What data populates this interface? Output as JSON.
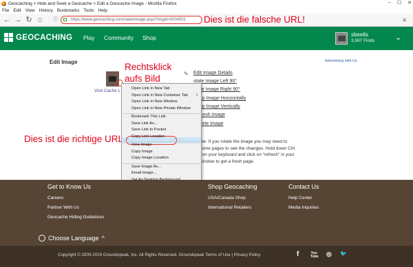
{
  "window": {
    "title": "Geocaching > Hide and Seek a Geocache > Edit a Geocache Image - Mozilla Firefox",
    "controls": {
      "minimize": "–",
      "maximize": "☐",
      "close": "✕"
    }
  },
  "menubar": [
    "File",
    "Edit",
    "View",
    "History",
    "Bookmarks",
    "Tools",
    "Help"
  ],
  "browser": {
    "url": "https://www.geocaching.com/seek/image.aspx?imgid=5004501",
    "icons": [
      "back-icon",
      "forward-icon",
      "reload-icon",
      "home-icon",
      "info-icon",
      "lock-icon",
      "menu-icon"
    ]
  },
  "annotations": {
    "url_note": "Dies ist die falsche URL!",
    "right_click": "Rechtsklick\naufs Bild",
    "correct_url": "Dies ist die richtige URL"
  },
  "header": {
    "logo": "GEOCACHING",
    "nav": [
      "Play",
      "Community",
      "Shop"
    ],
    "username": "sbeelis",
    "finds": "3,597 Finds"
  },
  "main": {
    "title": "Edit Image",
    "ads_link": "Advertising with Us",
    "visit_link": "Visit Cache L",
    "side_links": [
      "Edit Image Details",
      "Rotate Image Left 90°",
      "Rotate Image Right 90°",
      "Flip Image Horizontally",
      "Flip Image Vertically",
      "Refresh Image",
      "Delete Image"
    ],
    "side_links_visible": [
      "Edit Image Details",
      "otate Image Left 90°",
      "otate Image Right 90°",
      "ip Image Horizontally",
      "ip Image Vertically",
      "resh Image",
      "lete Image"
    ],
    "help_text": "ote: If you rotate the image you may need to\nsome pages to see the changes. Hold down Ctrl\nt on your keyboard and click on “refresh” in your\nwindow to get a fresh page."
  },
  "context_menu": {
    "items": [
      {
        "label": "Open Link in New Tab",
        "sub": false
      },
      {
        "label": "Open Link in New Container Tab",
        "sub": true
      },
      {
        "label": "Open Link in New Window",
        "sub": false
      },
      {
        "label": "Open Link in New Private Window",
        "sub": false
      },
      {
        "sep": true
      },
      {
        "label": "Bookmark This Link",
        "sub": false
      },
      {
        "label": "Save Link As...",
        "sub": false
      },
      {
        "label": "Save Link to Pocket",
        "sub": false
      },
      {
        "label": "Copy Link Location",
        "sub": false,
        "highlighted": true
      },
      {
        "sep": true
      },
      {
        "label": "View Image",
        "sub": false
      },
      {
        "label": "Copy Image",
        "sub": false
      },
      {
        "label": "Copy Image Location",
        "sub": false
      },
      {
        "sep": true
      },
      {
        "label": "Save Image As...",
        "sub": false
      },
      {
        "label": "Email Image...",
        "sub": false
      },
      {
        "label": "Set As Desktop Background...",
        "sub": false
      },
      {
        "label": "View Image Info",
        "sub": false
      },
      {
        "sep": true
      },
      {
        "label": "Send Link to Device",
        "sub": true
      },
      {
        "sep": true
      },
      {
        "label": "Inspect Element (Q)",
        "sub": false
      },
      {
        "sep": true
      },
      {
        "label": "Block element",
        "sub": false
      }
    ],
    "abp_label": "ABP"
  },
  "footer": {
    "columns": [
      {
        "heading": "Get to Know Us",
        "links": [
          "Careers",
          "Partner With Us",
          "Geocache Hiding Guidelines"
        ]
      },
      {
        "heading": "Shop Geocaching",
        "links": [
          "USA/Canada Shop",
          "International Retailers"
        ]
      },
      {
        "heading": "Contact Us",
        "links": [
          "Help Center",
          "Media Inquiries"
        ]
      }
    ],
    "language": "Choose Language",
    "copyright": "Copyright © 2000-2019 Groundspeak, Inc. All Rights Reserved. Groundspeak Terms of Use | Privacy Policy",
    "social": [
      "f",
      "You Tube",
      "◎",
      "🐦"
    ]
  }
}
